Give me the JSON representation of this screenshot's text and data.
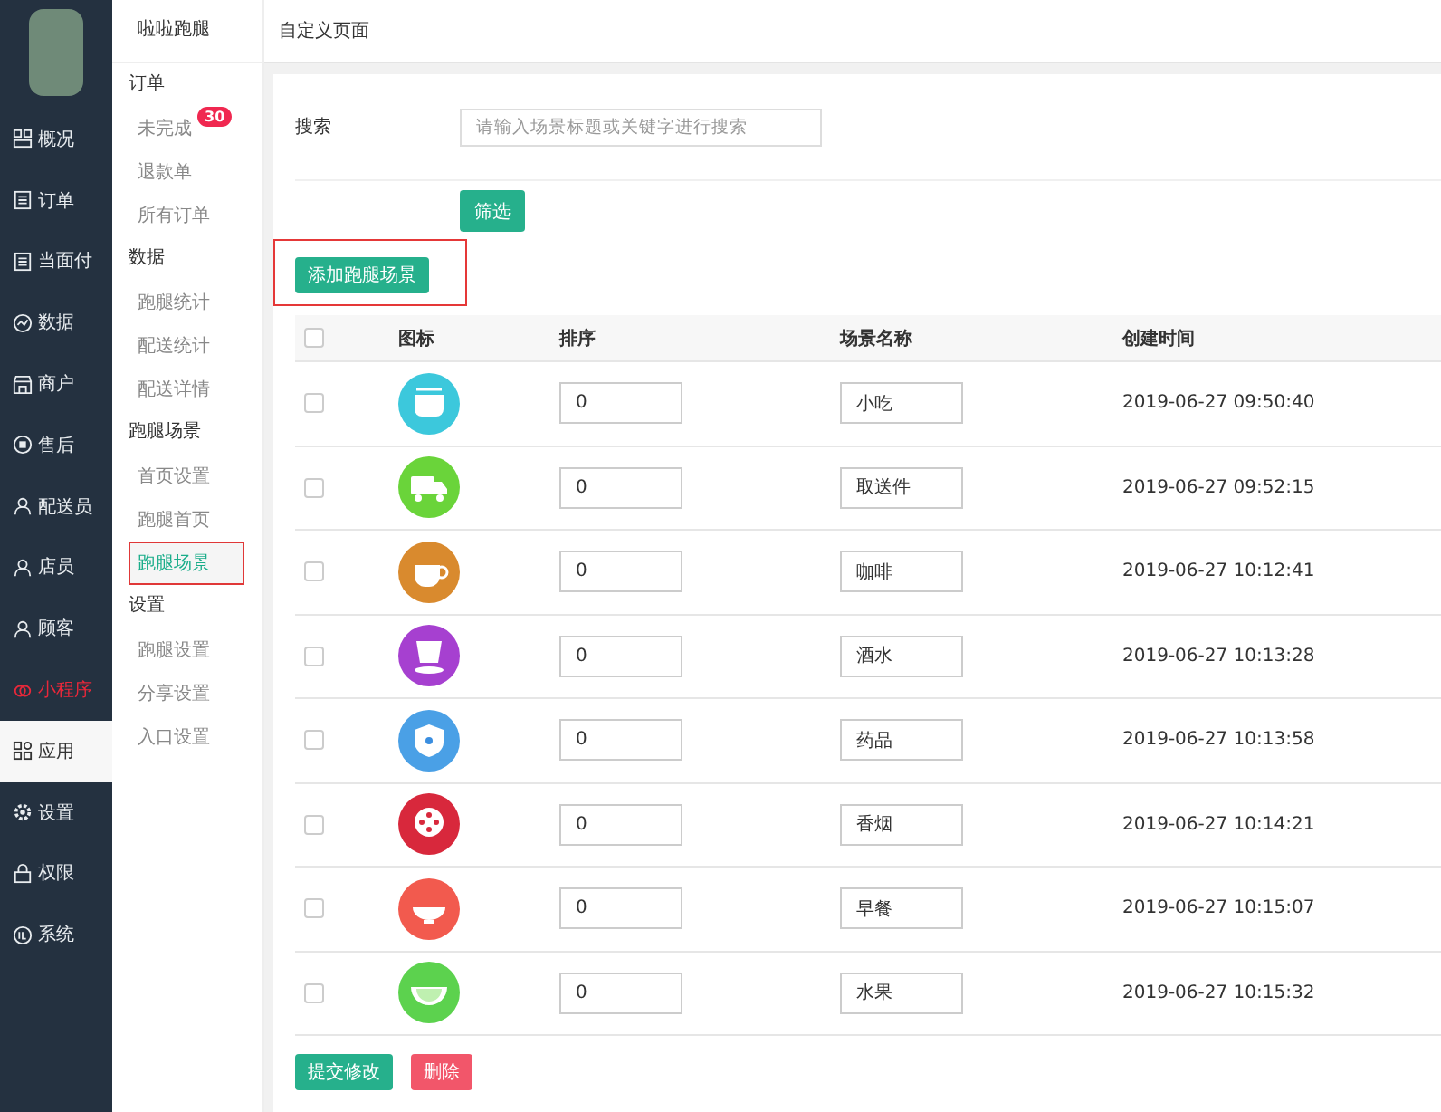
{
  "sidebar": {
    "items": [
      {
        "label": "概况",
        "kind": "grid",
        "selected": false,
        "highlight": false
      },
      {
        "label": "订单",
        "kind": "list",
        "selected": false,
        "highlight": false
      },
      {
        "label": "当面付",
        "kind": "list",
        "selected": false,
        "highlight": false
      },
      {
        "label": "数据",
        "kind": "chart",
        "selected": false,
        "highlight": false
      },
      {
        "label": "商户",
        "kind": "shop",
        "selected": false,
        "highlight": false
      },
      {
        "label": "售后",
        "kind": "headset",
        "selected": false,
        "highlight": false
      },
      {
        "label": "配送员",
        "kind": "person",
        "selected": false,
        "highlight": false
      },
      {
        "label": "店员",
        "kind": "person",
        "selected": false,
        "highlight": false
      },
      {
        "label": "顾客",
        "kind": "person",
        "selected": false,
        "highlight": false
      },
      {
        "label": "小程序",
        "kind": "link",
        "selected": false,
        "highlight": true
      },
      {
        "label": "应用",
        "kind": "apps",
        "selected": true,
        "highlight": false
      },
      {
        "label": "设置",
        "kind": "gear",
        "selected": false,
        "highlight": false
      },
      {
        "label": "权限",
        "kind": "lock",
        "selected": false,
        "highlight": false
      },
      {
        "label": "系统",
        "kind": "circle",
        "selected": false,
        "highlight": false
      }
    ]
  },
  "submenu": {
    "title": "啦啦跑腿",
    "groups": [
      {
        "label": "订单",
        "items": [
          {
            "label": "未完成",
            "badge": "30",
            "selected": false
          },
          {
            "label": "退款单",
            "selected": false
          },
          {
            "label": "所有订单",
            "selected": false
          }
        ]
      },
      {
        "label": "数据",
        "items": [
          {
            "label": "跑腿统计",
            "selected": false
          },
          {
            "label": "配送统计",
            "selected": false
          },
          {
            "label": "配送详情",
            "selected": false
          }
        ]
      },
      {
        "label": "跑腿场景",
        "items": [
          {
            "label": "首页设置",
            "selected": false
          },
          {
            "label": "跑腿首页",
            "selected": false
          },
          {
            "label": "跑腿场景",
            "selected": true
          }
        ]
      },
      {
        "label": "设置",
        "items": [
          {
            "label": "跑腿设置",
            "selected": false
          },
          {
            "label": "分享设置",
            "selected": false
          },
          {
            "label": "入口设置",
            "selected": false
          }
        ]
      }
    ]
  },
  "page_title": "自定义页面",
  "search": {
    "label": "搜索",
    "placeholder": "请输入场景标题或关键字进行搜索",
    "button": "筛选"
  },
  "add_button": "添加跑腿场景",
  "table": {
    "select_all_checked": false,
    "columns": [
      "图标",
      "排序",
      "场景名称",
      "创建时间"
    ],
    "rows": [
      {
        "checked": false,
        "icon": {
          "kind": "bowl",
          "color": "#3cc8dc"
        },
        "order": "0",
        "name": "小吃",
        "created": "2019-06-27 09:50:40"
      },
      {
        "checked": false,
        "icon": {
          "kind": "truck",
          "color": "#6ad43a"
        },
        "order": "0",
        "name": "取送件",
        "created": "2019-06-27 09:52:15"
      },
      {
        "checked": false,
        "icon": {
          "kind": "cup",
          "color": "#d98a2e"
        },
        "order": "0",
        "name": "咖啡",
        "created": "2019-06-27 10:12:41"
      },
      {
        "checked": false,
        "icon": {
          "kind": "mug",
          "color": "#a640d0"
        },
        "order": "0",
        "name": "酒水",
        "created": "2019-06-27 10:13:28"
      },
      {
        "checked": false,
        "icon": {
          "kind": "shield",
          "color": "#4aa0e6"
        },
        "order": "0",
        "name": "药品",
        "created": "2019-06-27 10:13:58"
      },
      {
        "checked": false,
        "icon": {
          "kind": "film",
          "color": "#d8283c"
        },
        "order": "0",
        "name": "香烟",
        "created": "2019-06-27 10:14:21"
      },
      {
        "checked": false,
        "icon": {
          "kind": "rice",
          "color": "#f25a4e"
        },
        "order": "0",
        "name": "早餐",
        "created": "2019-06-27 10:15:07"
      },
      {
        "checked": false,
        "icon": {
          "kind": "melon",
          "color": "#5cd24e"
        },
        "order": "0",
        "name": "水果",
        "created": "2019-06-27 10:15:32"
      }
    ]
  },
  "actions": [
    {
      "label": "提交修改",
      "kind": "primary"
    },
    {
      "label": "删除",
      "kind": "danger"
    }
  ]
}
